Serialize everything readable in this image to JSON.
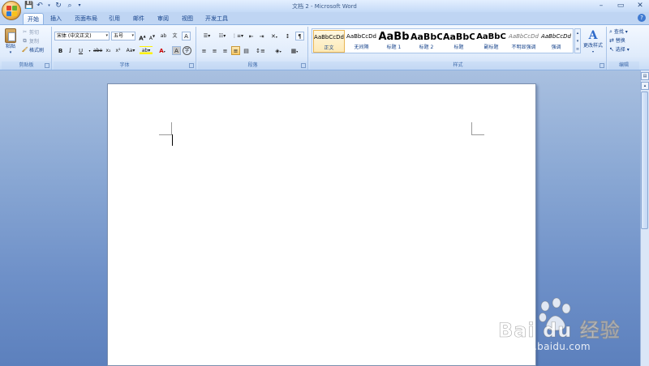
{
  "app": {
    "window_title": "文档 2 - Microsoft Word",
    "quick_access_icons": [
      "save-icon",
      "undo-icon",
      "redo-icon",
      "print-preview-icon",
      "customize-qat-icon"
    ]
  },
  "tabs": [
    "开始",
    "插入",
    "页面布局",
    "引用",
    "邮件",
    "审阅",
    "视图",
    "开发工具"
  ],
  "active_tab": "开始",
  "clipboard": {
    "paste": "粘贴",
    "cut": "剪切",
    "copy": "复制",
    "format_painter": "格式刷",
    "label": "剪贴板"
  },
  "font": {
    "font_name": "宋体 (中文正文)",
    "font_size": "五号",
    "label": "字体",
    "grow": "A",
    "shrink": "A",
    "bold": "B",
    "italic": "I",
    "underline": "U",
    "strikethrough": "abe",
    "subscript": "x₂",
    "superscript": "x²",
    "change_case": "Aa",
    "highlight": "ab",
    "font_color": "A",
    "char_shading": "A",
    "enclose": "字",
    "clear_format": "A",
    "phonetic": "文",
    "char_border": "A"
  },
  "paragraph": {
    "label": "段落"
  },
  "styles": {
    "label": "样式",
    "items": [
      {
        "sample": "AaBbCcDd",
        "name": "正文",
        "selected": true
      },
      {
        "sample": "AaBbCcDd",
        "name": "无间隔",
        "selected": false
      },
      {
        "sample": "AaBb",
        "name": "标题 1",
        "selected": false
      },
      {
        "sample": "AaBbC",
        "name": "标题 2",
        "selected": false
      },
      {
        "sample": "AaBbC",
        "name": "标题",
        "selected": false
      },
      {
        "sample": "AaBbC",
        "name": "副标题",
        "selected": false
      },
      {
        "sample": "AaBbCcDd",
        "name": "不明显强调",
        "selected": false
      },
      {
        "sample": "AaBbCcDd",
        "name": "强调",
        "selected": false
      }
    ],
    "change_styles": "更改样式"
  },
  "editing": {
    "label": "编辑",
    "find": "查找",
    "replace": "替换",
    "select": "选择"
  },
  "watermark": {
    "brand": "Bai du 经验",
    "url": "jingyan.baidu.com"
  },
  "colors": {
    "accent": "#15428b",
    "ribbon": "#dfebfb",
    "workspace": "#8aa8d4"
  }
}
